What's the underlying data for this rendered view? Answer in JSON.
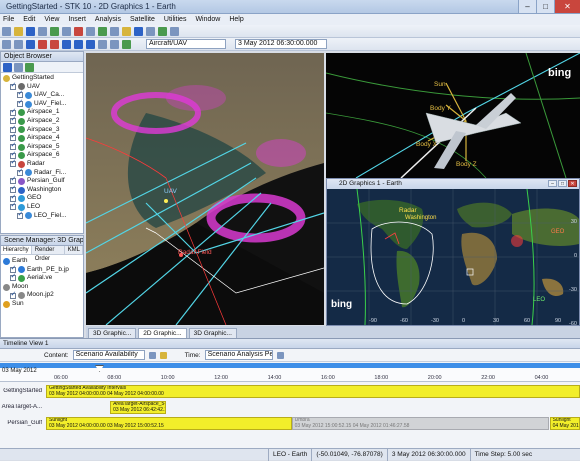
{
  "window": {
    "title": "GettingStarted - STK 10 - 2D Graphics 1 - Earth"
  },
  "menu": [
    "File",
    "Edit",
    "View",
    "Insert",
    "Analysis",
    "Satellite",
    "Utilities",
    "Window",
    "Help"
  ],
  "toolbar2": {
    "object_combo": "Aircraft/UAV",
    "date_combo": "3 May 2012 06:30:00.000"
  },
  "object_browser": {
    "title": "Object Browser",
    "items": [
      {
        "label": "GettingStarted",
        "icon": "scenario-icon",
        "indent": 0,
        "checked": null
      },
      {
        "label": "UAV",
        "icon": "aircraft-icon",
        "indent": 1,
        "checked": true
      },
      {
        "label": "UAV_Ca...",
        "icon": "sensor-icon",
        "indent": 2,
        "checked": true
      },
      {
        "label": "UAV_Fiel...",
        "icon": "sensor-icon",
        "indent": 2,
        "checked": true
      },
      {
        "label": "Airspace_1",
        "icon": "area-icon",
        "indent": 1,
        "checked": true
      },
      {
        "label": "Airspace_2",
        "icon": "area-icon",
        "indent": 1,
        "checked": true
      },
      {
        "label": "Airspace_3",
        "icon": "area-icon",
        "indent": 1,
        "checked": true
      },
      {
        "label": "Airspace_4",
        "icon": "area-icon",
        "indent": 1,
        "checked": true
      },
      {
        "label": "Airspace_5",
        "icon": "area-icon",
        "indent": 1,
        "checked": true
      },
      {
        "label": "Airspace_6",
        "icon": "area-icon",
        "indent": 1,
        "checked": true
      },
      {
        "label": "Radar",
        "icon": "facility-icon",
        "indent": 1,
        "checked": true
      },
      {
        "label": "Radar_Fi...",
        "icon": "sensor-icon",
        "indent": 2,
        "checked": true
      },
      {
        "label": "Persian_Gulf",
        "icon": "target-icon",
        "indent": 1,
        "checked": true
      },
      {
        "label": "Washington",
        "icon": "place-icon",
        "indent": 1,
        "checked": true
      },
      {
        "label": "GEO",
        "icon": "satellite-icon",
        "indent": 1,
        "checked": true
      },
      {
        "label": "LEO",
        "icon": "satellite-icon",
        "indent": 1,
        "checked": true
      },
      {
        "label": "LEO_Fiel...",
        "icon": "sensor-icon",
        "indent": 2,
        "checked": true
      }
    ]
  },
  "scene_manager": {
    "title": "Scene Manager: 3D Graphic...",
    "tabs": [
      "Hierarchy",
      "Render Order",
      "KML"
    ],
    "items": [
      {
        "label": "Earth",
        "indent": 0,
        "color": "#2c7ad8"
      },
      {
        "label": "Earth_PE_b.jp",
        "indent": 1,
        "color": "#2c7ad8"
      },
      {
        "label": "Aerial.ve",
        "indent": 1,
        "color": "#3aa24a"
      },
      {
        "label": "Moon",
        "indent": 0,
        "color": "#888"
      },
      {
        "label": "Moon.jp2",
        "indent": 1,
        "color": "#888"
      },
      {
        "label": "Sun",
        "indent": 0,
        "color": "#e0a020"
      }
    ]
  },
  "views": {
    "view3d_labels": {
      "uav": "UAV",
      "radar": "Radar Field"
    },
    "uav_body_labels": {
      "sun": "Sun",
      "body_y": "Body Y",
      "body_x": "Body X",
      "body_z": "Body Z"
    },
    "bing_logo": "bing",
    "map2d": {
      "title": "2D Graphics 1 - Earth",
      "labels": {
        "radar": "Radar",
        "washington": "Washington",
        "geo": "GEO",
        "leo": "LEO"
      },
      "lat_ticks": [
        "30",
        "0",
        "-30",
        "-60"
      ],
      "lon_ticks": [
        "-90",
        "-60",
        "-30",
        "0",
        "30",
        "60",
        "90"
      ]
    }
  },
  "view_tabs": [
    {
      "label": "3D Graphic...",
      "active": false
    },
    {
      "label": "2D Graphic...",
      "active": true
    },
    {
      "label": "3D Graphic...",
      "active": false
    }
  ],
  "timeline": {
    "title": "Timeline View 1",
    "content_label": "Content:",
    "content_value": "Scenario Availability",
    "time_label": "Time:",
    "time_value": "Scenario Analysis Perio",
    "date_label": "03 May 2012",
    "ticks": [
      "06:00",
      "08:00",
      "10:00",
      "12:00",
      "14:00",
      "16:00",
      "18:00",
      "20:00",
      "22:00",
      "04:00"
    ],
    "rows": [
      {
        "label": "GettingStarted",
        "bars": [
          {
            "kind": "yellow",
            "text": "GettingStarted Availability Intervals",
            "text2": "03 May 2012 04:00:00.00      04 May 2012 04:00:00.00",
            "start": 0.0,
            "end": 1.0
          }
        ]
      },
      {
        "label": "AreaTarget-A...",
        "bars": [
          {
            "kind": "yellow",
            "text": "AreaTarget-Airspace_5-T",
            "text2": "03 May 2012 06:42:42.18",
            "start": 0.12,
            "end": 0.225
          }
        ]
      },
      {
        "label": "Persian_Gulf",
        "bars": [
          {
            "kind": "yellow",
            "text": "Sunlight",
            "text2": "03 May 2012 04:00:00.00      03 May 2012 15:00:52.15",
            "start": 0.0,
            "end": 0.46
          },
          {
            "kind": "grey",
            "text": "Umbra",
            "text2": "03 May 2012 15:00:52.15      04 May 2012 01:46:27.58",
            "start": 0.46,
            "end": 0.943
          },
          {
            "kind": "yellow",
            "text": "Sunlight",
            "text2": "04 May 2012",
            "start": 0.943,
            "end": 1.0
          }
        ]
      }
    ]
  },
  "statusbar": {
    "frame": "LEO - Earth",
    "coords": "(-50.01049, -76.87078)",
    "time": "3 May 2012 06:30:00.000",
    "step": "Time Step: 5.00 sec"
  }
}
